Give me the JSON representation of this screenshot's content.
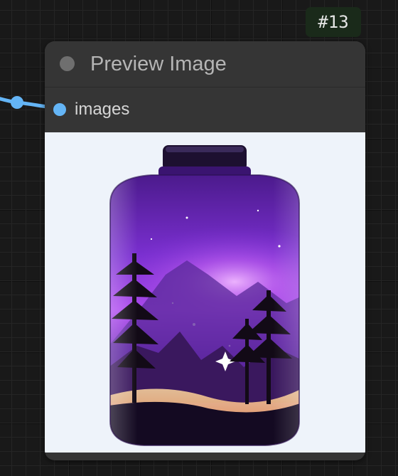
{
  "node": {
    "id_badge": "#13",
    "title": "Preview Image",
    "input": {
      "label": "images",
      "slot_color": "#64b5f6"
    },
    "preview": {
      "subject": "glass jar terrarium with purple galaxy sky, mountains and pine trees"
    }
  },
  "colors": {
    "canvas_background": "#191919",
    "node_background": "#353535",
    "badge_background": "#1a2a1a",
    "link_wire": "#64b5f6",
    "collapse_dot": "#6f6f6f"
  }
}
